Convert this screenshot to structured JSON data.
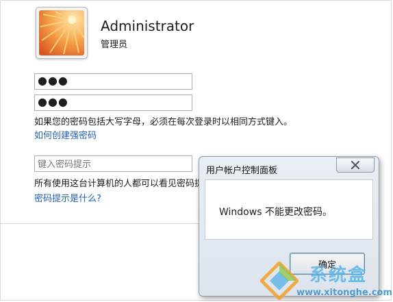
{
  "user": {
    "name": "Administrator",
    "role": "管理员"
  },
  "form": {
    "new_password_value": "●●●",
    "confirm_password_value": "●●●",
    "caps_note": "如果您的密码包括大写字母，必须在每次登录时以相同方式键入。",
    "strong_password_link": "如何创建强密码",
    "hint_placeholder": "键入密码提示",
    "hint_note": "所有使用这台计算机的人都可以看见密码提示。",
    "hint_link": "密码提示是什么?"
  },
  "dialog": {
    "title": "用户帐户控制面板",
    "message": "Windows 不能更改密码。",
    "ok_label": "确定"
  },
  "watermark": {
    "name": "系统盒",
    "url": "www.xitonghe.com"
  },
  "icons": {
    "close": "close-icon",
    "avatar": "flower-avatar-icon",
    "logo": "watermark-logo-icon"
  },
  "colors": {
    "link": "#1f5eb0",
    "watermark": "#5ab4e6"
  }
}
